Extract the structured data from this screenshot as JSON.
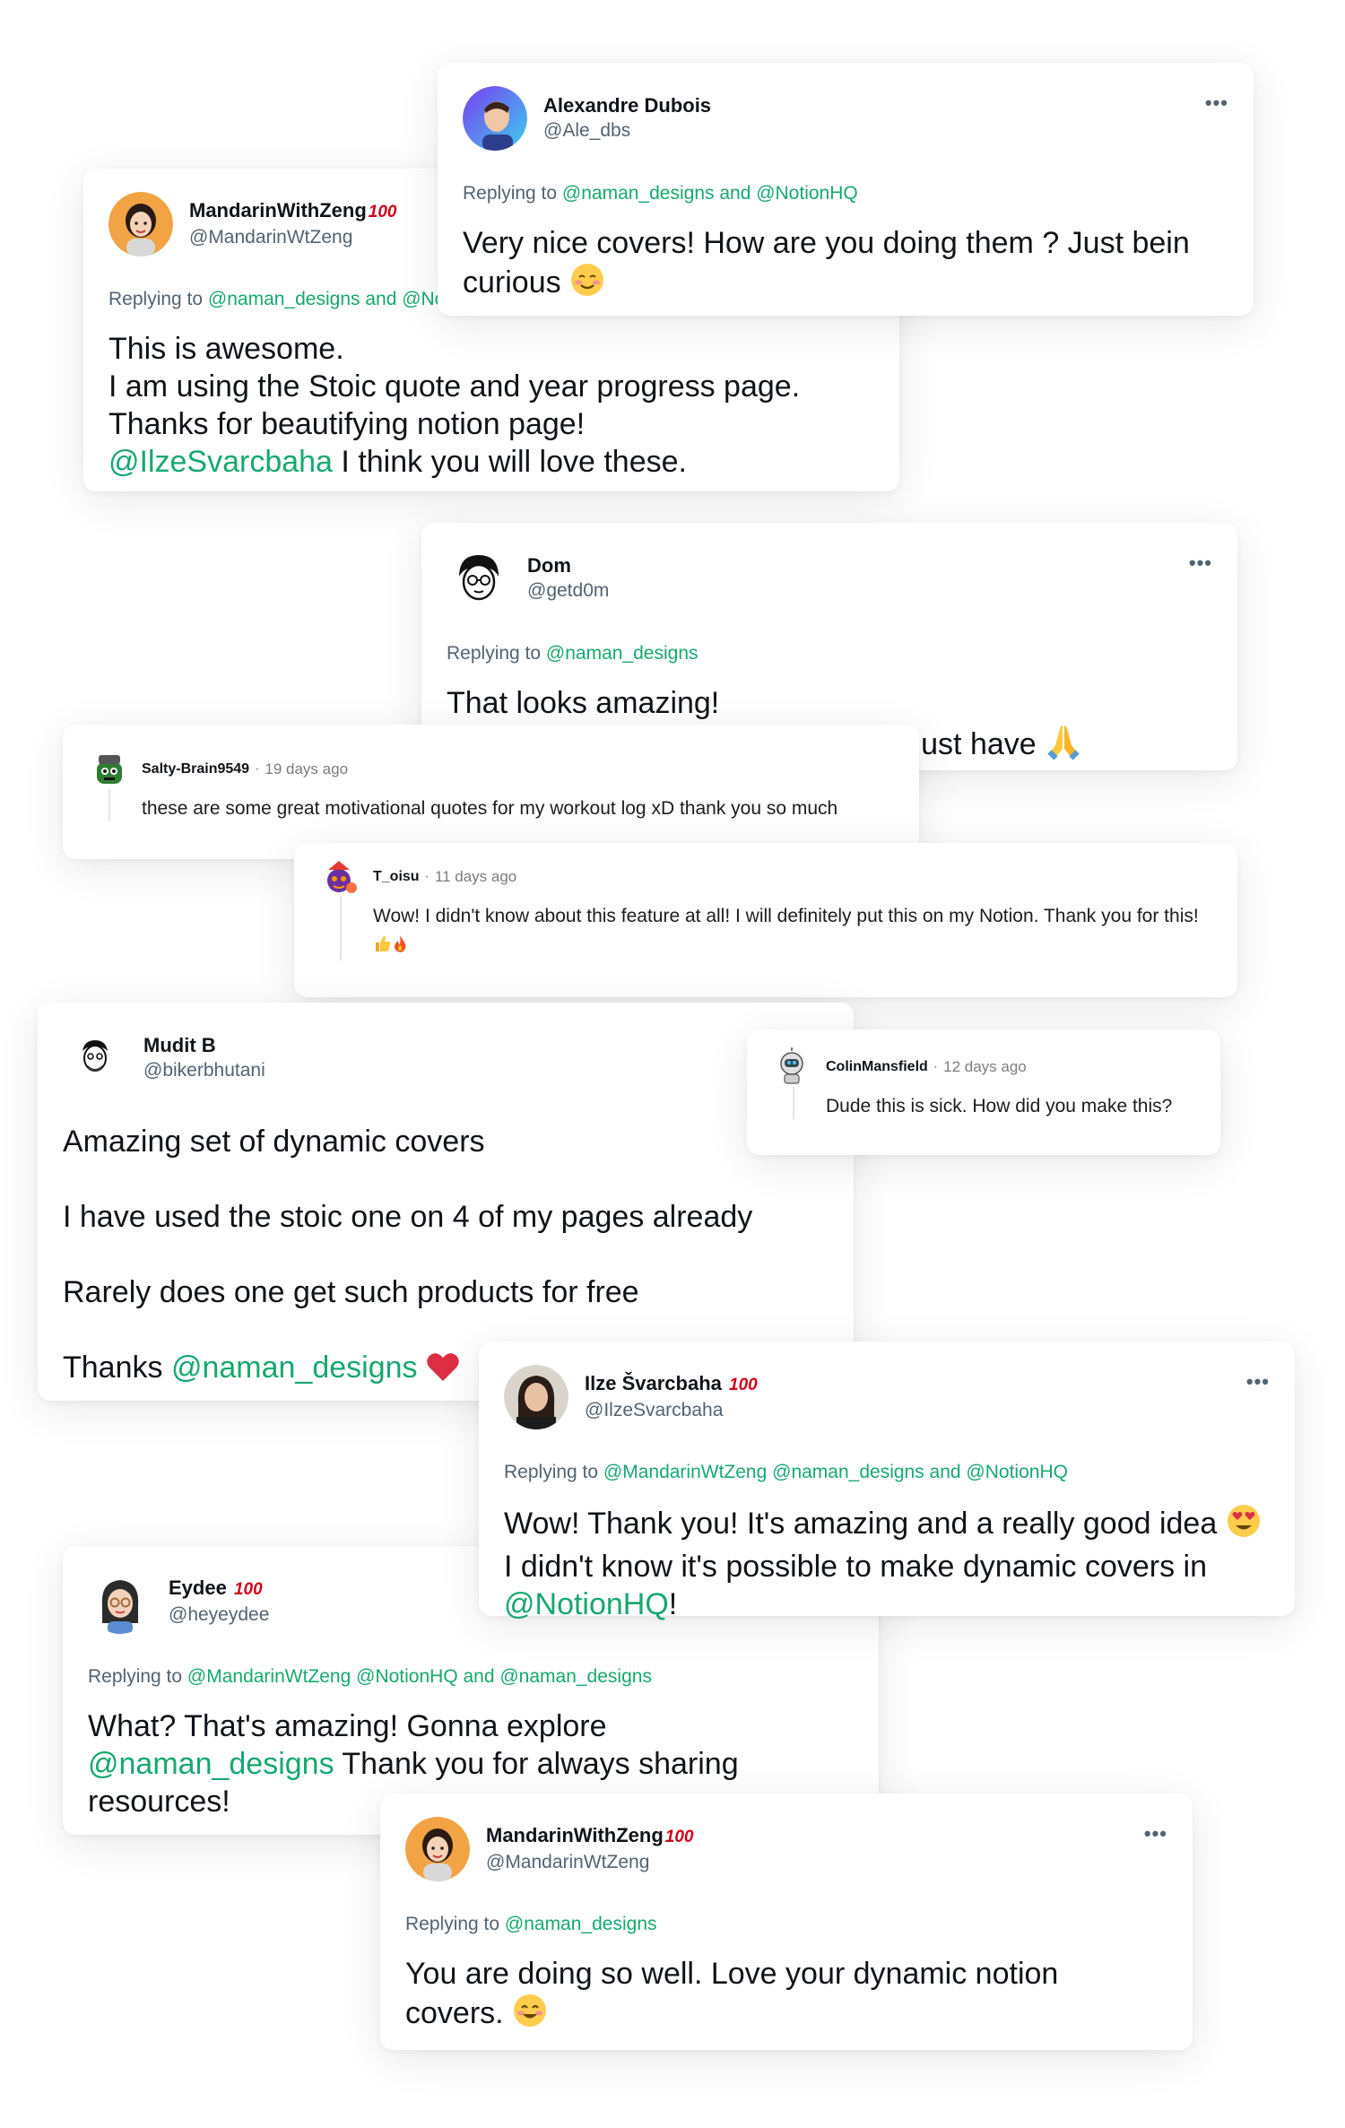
{
  "tweets": {
    "alexandre": {
      "name": "Alexandre Dubois",
      "handle": "@Ale_dbs",
      "reply_prefix": "Replying to",
      "reply_to": "@naman_designs and @NotionHQ",
      "text_1": "Very nice covers! How are you doing them ? Just bein curious",
      "emoji": "smiling-blush-emoji"
    },
    "mandarin1": {
      "name": "MandarinWithZeng",
      "badge": "100",
      "handle": "@MandarinWtZeng",
      "reply_prefix": "Replying to",
      "reply_to": "@naman_designs and @NotionHQ",
      "line_1": "This is awesome.",
      "line_2": "I am using the Stoic quote and year progress page.",
      "line_3": "Thanks for beautifying notion page!",
      "mention": "@IlzeSvarcbaha",
      "line_4": " I think you will love these."
    },
    "dom": {
      "name": "Dom",
      "handle": "@getd0m",
      "reply_prefix": "Replying to",
      "reply_to": "@naman_designs",
      "line_1": "That looks amazing!",
      "line_2": "Todays horoscope will become a must have",
      "emoji": "praying-hands-emoji"
    },
    "mudit": {
      "name": "Mudit B",
      "handle": "@bikerbhutani",
      "line_1": "Amazing set of dynamic covers",
      "line_2": "I have used the stoic one on 4 of my pages already",
      "line_3": "Rarely does one get such products for free",
      "line_4": "Thanks ",
      "mention": "@naman_designs",
      "emoji": "red-heart-emoji"
    },
    "ilze": {
      "name": "Ilze Švarcbaha",
      "badge": "100",
      "handle": "@IlzeSvarcbaha",
      "reply_prefix": "Replying to",
      "reply_to": "@MandarinWtZeng @naman_designs and @NotionHQ",
      "text_1": "Wow! Thank you! It's amazing and a really good idea",
      "text_2": " I didn't know it's possible to make dynamic covers in ",
      "mention": "@NotionHQ",
      "text_3": "!",
      "emoji": "heart-eyes-emoji"
    },
    "eydee": {
      "name": "Eydee",
      "badge": "100",
      "handle": "@heyeydee",
      "reply_prefix": "Replying to",
      "reply_to": "@MandarinWtZeng @NotionHQ and @naman_designs",
      "text_1": "What? That's amazing! Gonna explore ",
      "mention": "@naman_designs",
      "text_2": " Thank you for always sharing resources!"
    },
    "mandarin2": {
      "name": "MandarinWithZeng",
      "badge": "100",
      "handle": "@MandarinWtZeng",
      "reply_prefix": "Replying to",
      "reply_to": "@naman_designs",
      "text_1": "You are doing so well. Love your dynamic notion covers.",
      "emoji": "smiling-emoji"
    }
  },
  "reddit": {
    "salty": {
      "user": "Salty-Brain9549",
      "sep": "·",
      "time": "19 days ago",
      "text": "these are some great motivational quotes for my workout log xD thank you so much"
    },
    "toisu": {
      "user": "T_oisu",
      "sep": "·",
      "time": "11 days ago",
      "text": "Wow! I didn't know about this feature at all! I will definitely put this on my Notion. Thank you for this!",
      "emoji": "thumbs-up-fire-emoji"
    },
    "colin": {
      "user": "ColinMansfield",
      "sep": "·",
      "time": "12 days ago",
      "text": "Dude this is sick. How did you make this?"
    }
  },
  "more_label": "•••",
  "colors": {
    "mention": "#17a870",
    "muted": "#536471",
    "badge": "#d0021b"
  }
}
